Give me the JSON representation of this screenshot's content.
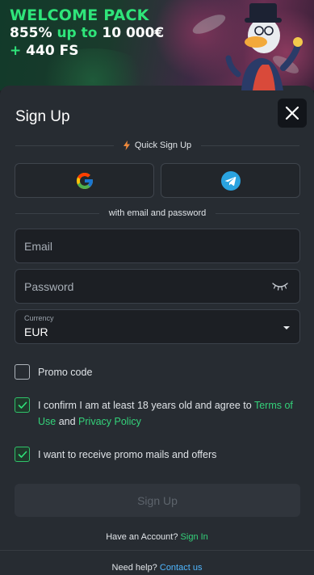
{
  "banner": {
    "title": "WELCOME PACK",
    "bonus_percent": "855%",
    "bonus_up_to": "up to",
    "bonus_amount": "10 000€",
    "bonus_plus": "+",
    "free_spins": "440 FS"
  },
  "modal": {
    "title": "Sign Up",
    "close_icon": "close-icon"
  },
  "quick_signup": {
    "label": "Quick Sign Up",
    "icon": "lightning-icon",
    "providers": [
      {
        "name": "google-icon"
      },
      {
        "name": "telegram-icon"
      }
    ]
  },
  "email_section": {
    "label": "with email and password"
  },
  "form": {
    "email_placeholder": "Email",
    "password_placeholder": "Password",
    "password_toggle_icon": "eye-closed-icon",
    "currency_label": "Currency",
    "currency_value": "EUR"
  },
  "checks": {
    "promo_code": {
      "label": "Promo code",
      "checked": false
    },
    "terms": {
      "text_before": "I confirm I am at least 18 years old and agree to ",
      "terms_link": "Terms of Use",
      "text_middle": " and ",
      "privacy_link": "Privacy Policy",
      "checked": true
    },
    "promo_mails": {
      "label": "I want to receive promo mails and offers",
      "checked": true
    }
  },
  "submit_label": "Sign Up",
  "account": {
    "prompt": "Have an Account?",
    "link": "Sign In"
  },
  "help": {
    "prompt": "Need help?",
    "link": "Contact us"
  },
  "colors": {
    "accent_green": "#2fe57a",
    "link_blue": "#4fb6ff",
    "modal_bg": "#272c32"
  }
}
